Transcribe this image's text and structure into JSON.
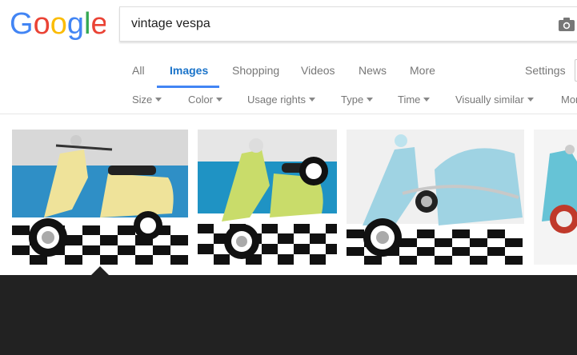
{
  "logo": {
    "text": "Google",
    "colors": [
      "#4285F4",
      "#EA4335",
      "#FBBC05",
      "#4285F4",
      "#34A853",
      "#EA4335"
    ]
  },
  "search": {
    "query": "vintage vespa",
    "camera_icon": "camera-icon"
  },
  "tabs": [
    {
      "label": "All",
      "active": false
    },
    {
      "label": "Images",
      "active": true
    },
    {
      "label": "Shopping",
      "active": false
    },
    {
      "label": "Videos",
      "active": false
    },
    {
      "label": "News",
      "active": false
    },
    {
      "label": "More",
      "active": false
    }
  ],
  "settings_label": "Settings",
  "filters": [
    {
      "label": "Size",
      "dropdown": true
    },
    {
      "label": "Color",
      "dropdown": true
    },
    {
      "label": "Usage rights",
      "dropdown": true
    },
    {
      "label": "Type",
      "dropdown": true
    },
    {
      "label": "Time",
      "dropdown": true
    },
    {
      "label": "Visually similar",
      "dropdown": true
    },
    {
      "label": "Mor",
      "dropdown": false
    }
  ],
  "results": [
    {
      "subject": "yellow vintage scooter",
      "body_color": "#efe39a",
      "wall_color": "#2f8fc6"
    },
    {
      "subject": "green vintage scooter",
      "body_color": "#c9dc6a",
      "wall_color": "#1f93c4"
    },
    {
      "subject": "light blue vintage scooter with sidecar",
      "body_color": "#9fd3e3",
      "wall_color": "#f0f0f0"
    },
    {
      "subject": "light blue vintage scooter (partially visible)",
      "body_color": "#66c3d6",
      "wall_color": "#f4f4f4"
    }
  ],
  "colors": {
    "active_tab": "#1a73c9",
    "tab_underline": "#4285f4",
    "panel": "#222222"
  }
}
